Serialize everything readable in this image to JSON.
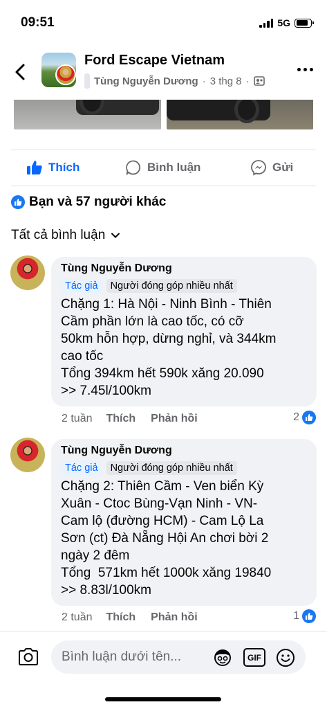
{
  "status_bar": {
    "time": "09:51",
    "network": "5G"
  },
  "header": {
    "title": "Ford Escape Vietnam",
    "author": "Tùng Nguyễn Dương",
    "date": "3 thg 8",
    "separator": "·"
  },
  "actions": {
    "like": "Thích",
    "comment": "Bình luận",
    "share": "Gửi"
  },
  "reactions_text": "Bạn và 57 người khác",
  "filter_label": "Tất cả bình luận",
  "comments": [
    {
      "name": "Tùng Nguyễn Dương",
      "badge_author": "Tác giả",
      "badge_top": "Người đóng góp nhiều nhất",
      "text": "Chặng 1: Hà Nội - Ninh Bình - Thiên\nCầm phần lớn là cao tốc, có cỡ\n50km hỗn hợp, dừng nghỉ, và 344km\ncao tốc\nTổng 394km hết 590k xăng 20.090\n>> 7.45l/100km",
      "time": "2 tuần",
      "like": "Thích",
      "reply": "Phản hồi",
      "likes": "2"
    },
    {
      "name": "Tùng Nguyễn Dương",
      "badge_author": "Tác giả",
      "badge_top": "Người đóng góp nhiều nhất",
      "text": "Chặng 2: Thiên Cầm - Ven biển Kỳ\nXuân - Ctoc Bùng-Vạn Ninh - VN-\nCam lộ (đường HCM) - Cam Lộ La\nSơn (ct) Đà Nẵng Hội An chơi bời 2\nngày 2 đêm\nTổng  571km hết 1000k xăng 19840\n>> 8.83l/100km",
      "time": "2 tuần",
      "like": "Thích",
      "reply": "Phản hồi",
      "likes": "1"
    }
  ],
  "composer": {
    "placeholder": "Bình luận dưới tên...",
    "gif": "GIF"
  },
  "colors": {
    "brand_blue": "#0866ff",
    "like_blue": "#1877f2",
    "bubble_bg": "#f0f2f5",
    "muted": "#65676b"
  }
}
